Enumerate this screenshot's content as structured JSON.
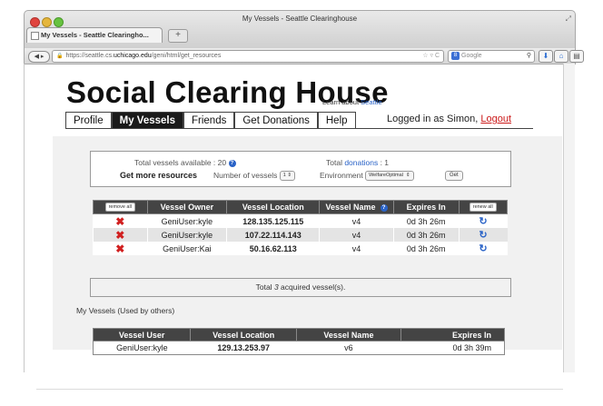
{
  "window": {
    "title": "My Vessels - Seattle Clearinghouse",
    "tab_label": "My Vessels - Seattle Clearingho...",
    "new_tab": "+"
  },
  "toolbar": {
    "url_prefix": "https://seattle.cs.",
    "url_host": "uchicago.edu",
    "url_path": "/geni/html/get_resources",
    "search_placeholder": "Google"
  },
  "site": {
    "title": "Social Clearing House",
    "learn_text": "Learn about",
    "learn_link": "Seattle"
  },
  "nav": {
    "tabs": [
      {
        "label": "Profile"
      },
      {
        "label": "My Vessels"
      },
      {
        "label": "Friends"
      },
      {
        "label": "Get Donations"
      },
      {
        "label": "Help"
      }
    ],
    "logged_in_text": "Logged in as Simon,",
    "logout_label": "Logout"
  },
  "summary": {
    "available_label": "Total vessels available : ",
    "available_value": "20",
    "donations_label": "Total ",
    "donations_link": "donations",
    "donations_value": " : 1",
    "get_more": "Get more resources",
    "num_vessels_label": "Number of vessels",
    "num_vessels_value": "1",
    "environment_label": "Environment",
    "environment_value": "WelfareOptimal",
    "get_button": "Get"
  },
  "vessels_table": {
    "remove_all": "remove all",
    "renew_all": "renew all",
    "headers": {
      "owner": "Vessel Owner",
      "location": "Vessel Location",
      "name": "Vessel Name",
      "expires": "Expires In"
    },
    "rows": [
      {
        "owner": "GeniUser:kyle",
        "location": "128.135.125.115",
        "name": "v4",
        "expires": "0d 3h 26m"
      },
      {
        "owner": "GeniUser:kyle",
        "location": "107.22.114.143",
        "name": "v4",
        "expires": "0d 3h 26m"
      },
      {
        "owner": "GeniUser:Kai",
        "location": "50.16.62.113",
        "name": "v4",
        "expires": "0d 3h 26m"
      }
    ]
  },
  "total": {
    "prefix": "Total ",
    "count": "3",
    "suffix": " acquired vessel(s)."
  },
  "others": {
    "title": "My Vessels (Used by others)",
    "headers": {
      "user": "Vessel User",
      "location": "Vessel Location",
      "name": "Vessel Name",
      "expires": "Expires In"
    },
    "rows": [
      {
        "user": "GeniUser:kyle",
        "location": "129.13.253.97",
        "name": "v6",
        "expires": "0d 3h 39m"
      }
    ]
  },
  "icons": {
    "remove": "x-icon",
    "renew": "renew-icon",
    "help": "question-icon"
  },
  "colors": {
    "accent_link": "#2a63c7",
    "logout": "#cc1a1a",
    "remove_x": "#d12020",
    "header_bg": "#444444"
  }
}
